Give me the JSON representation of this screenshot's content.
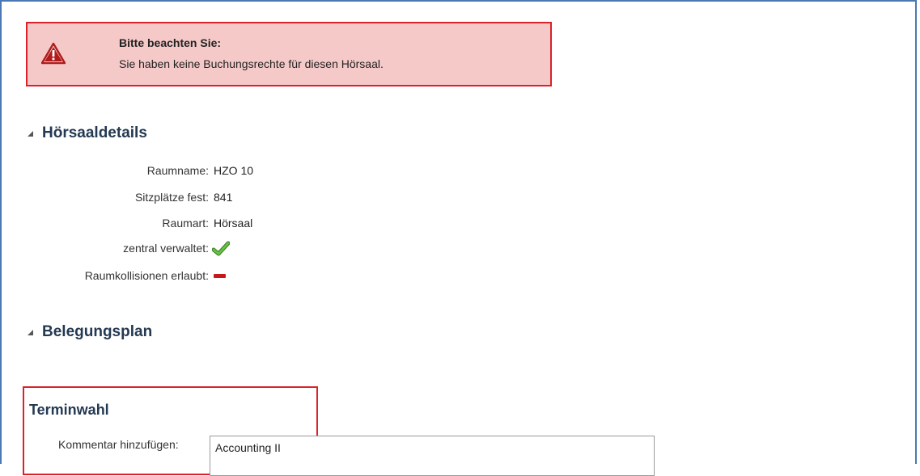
{
  "alert": {
    "title": "Bitte beachten Sie:",
    "message": "Sie haben keine Buchungsrechte für diesen Hörsaal.",
    "icon": "warning-icon",
    "background": "#f6c9c9",
    "border": "#d9222a"
  },
  "details": {
    "title": "Hörsaaldetails",
    "rows": [
      {
        "label": "Raumname:",
        "value": "HZO 10"
      },
      {
        "label": "Sitzplätze fest:",
        "value": "841"
      },
      {
        "label": "Raumart:",
        "value": "Hörsaal"
      },
      {
        "label": "zentral verwaltet:",
        "value_icon": "check-icon"
      },
      {
        "label": "Raumkollisionen erlaubt:",
        "value_icon": "minus-icon"
      }
    ]
  },
  "schedule": {
    "title": "Belegungsplan"
  },
  "terminwahl": {
    "title": "Terminwahl",
    "comment_label": "Kommentar hinzufügen:",
    "comment_value": "Accounting II"
  },
  "colors": {
    "heading": "#243952",
    "accent_red": "#d9222a",
    "frame_blue": "#4a78b5",
    "check_green": "#5aa53a"
  }
}
